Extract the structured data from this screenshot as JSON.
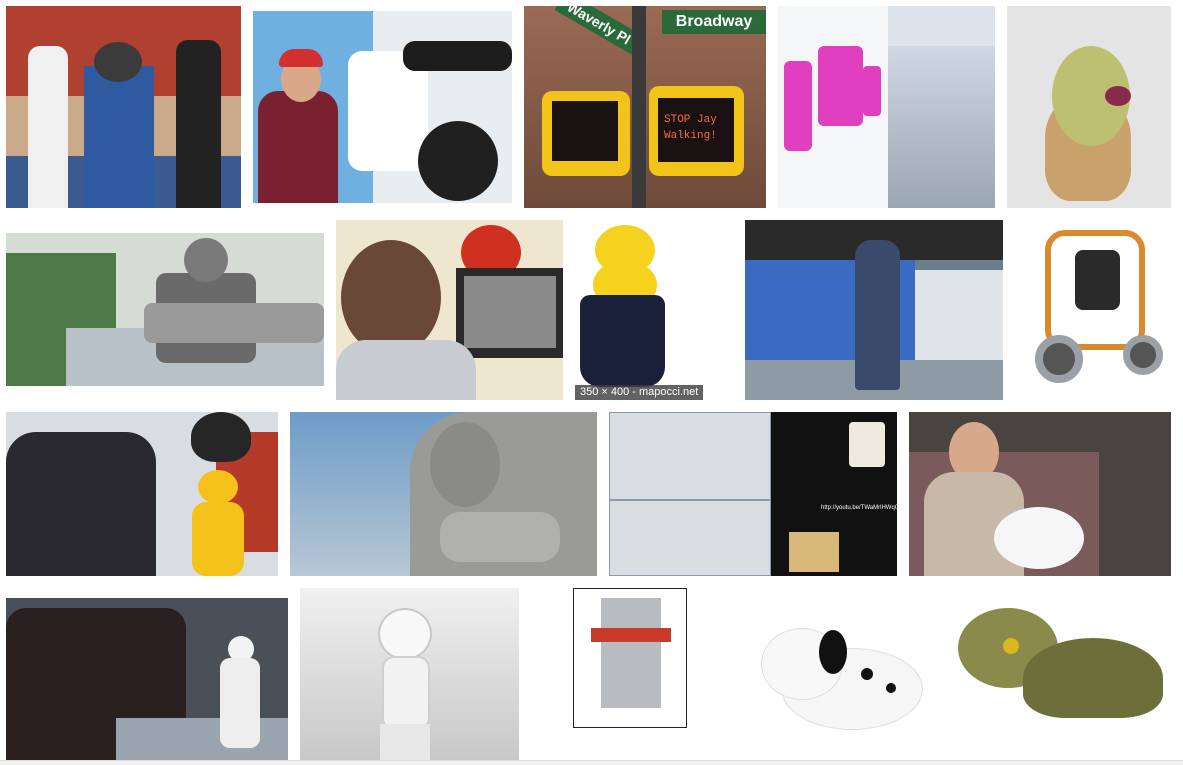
{
  "results": {
    "images": [
      {
        "name": "robot-exhibit-thumb"
      },
      {
        "name": "robot-arm-drawing-thumb"
      },
      {
        "name": "traffic-signal-thumb",
        "signs": {
          "street_left": "Waverly Pl",
          "street_right": "Broadway"
        },
        "signal_text": "STOP Jay Walking!"
      },
      {
        "name": "hallway-robot-faces-thumb"
      },
      {
        "name": "leopard-head-thumb"
      },
      {
        "name": "humanoid-robot-thumb"
      },
      {
        "name": "boy-computer-thumb"
      },
      {
        "name": "keepon-robot-thumb",
        "caption": "350 × 400 - mapocci.net"
      },
      {
        "name": "exoskeleton-robot-thumb"
      },
      {
        "name": "balancing-robot-kit-thumb"
      },
      {
        "name": "yellow-robot-crowd-thumb"
      },
      {
        "name": "statue-thumb"
      },
      {
        "name": "cad-parts-thumb",
        "url_text": "http://youtu.be/TWaMrlHWqQ"
      },
      {
        "name": "seal-robot-man-thumb"
      },
      {
        "name": "asimo-crowd-thumb"
      },
      {
        "name": "nao-robot-thumb"
      },
      {
        "name": "robot-diagram-thumb"
      },
      {
        "name": "dalmatian-toy-thumb"
      },
      {
        "name": "dinosaur-toy-thumb"
      }
    ]
  }
}
